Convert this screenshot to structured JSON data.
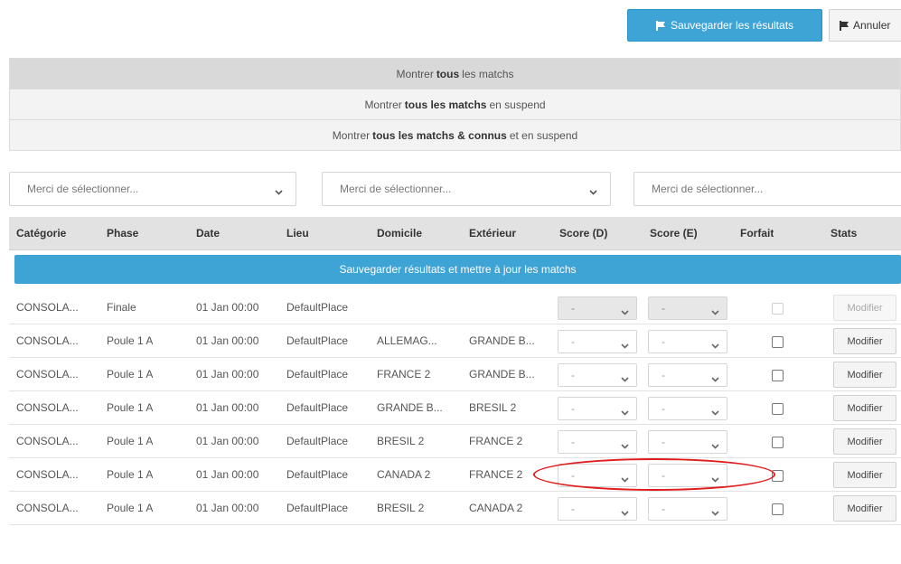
{
  "toolbar": {
    "save_label": "Sauvegarder les résultats",
    "cancel_label": "Annuler",
    "save_icon": "flag-icon",
    "cancel_icon": "flag-icon"
  },
  "filters": {
    "show_all": {
      "prefix": "Montrer",
      "bold": "tous",
      "suffix": "les matchs"
    },
    "show_pending": {
      "prefix": "Montrer",
      "bold": "tous les matchs",
      "suffix": "en suspend"
    },
    "show_known": {
      "prefix": "Montrer",
      "bold": "tous les matchs & connus",
      "suffix": "et en suspend"
    }
  },
  "selects": [
    {
      "placeholder": "Merci de sélectionner..."
    },
    {
      "placeholder": "Merci de sélectionner..."
    },
    {
      "placeholder": "Merci de sélectionner..."
    }
  ],
  "table": {
    "headers": {
      "categorie": "Catégorie",
      "phase": "Phase",
      "date": "Date",
      "lieu": "Lieu",
      "domicile": "Domicile",
      "exterieur": "Extérieur",
      "score_d": "Score (D)",
      "score_e": "Score (E)",
      "forfait": "Forfait",
      "stats": "Stats"
    },
    "banner": "Sauvegarder résultats et mettre à jour les matchs",
    "score_placeholder": "-",
    "modify_label": "Modifier",
    "rows": [
      {
        "categorie": "CONSOLA...",
        "phase": "Finale",
        "date": "01 Jan 00:00",
        "lieu": "DefaultPlace",
        "domicile": "",
        "exterieur": "",
        "disabled": true
      },
      {
        "categorie": "CONSOLA...",
        "phase": "Poule 1 A",
        "date": "01 Jan 00:00",
        "lieu": "DefaultPlace",
        "domicile": "ALLEMAG...",
        "exterieur": "GRANDE B...",
        "disabled": false
      },
      {
        "categorie": "CONSOLA...",
        "phase": "Poule 1 A",
        "date": "01 Jan 00:00",
        "lieu": "DefaultPlace",
        "domicile": "FRANCE 2",
        "exterieur": "GRANDE B...",
        "disabled": false
      },
      {
        "categorie": "CONSOLA...",
        "phase": "Poule 1 A",
        "date": "01 Jan 00:00",
        "lieu": "DefaultPlace",
        "domicile": "GRANDE B...",
        "exterieur": "BRESIL 2",
        "disabled": false
      },
      {
        "categorie": "CONSOLA...",
        "phase": "Poule 1 A",
        "date": "01 Jan 00:00",
        "lieu": "DefaultPlace",
        "domicile": "BRESIL 2",
        "exterieur": "FRANCE 2",
        "disabled": false
      },
      {
        "categorie": "CONSOLA...",
        "phase": "Poule 1 A",
        "date": "01 Jan 00:00",
        "lieu": "DefaultPlace",
        "domicile": "CANADA 2",
        "exterieur": "FRANCE 2",
        "disabled": false
      },
      {
        "categorie": "CONSOLA...",
        "phase": "Poule 1 A",
        "date": "01 Jan 00:00",
        "lieu": "DefaultPlace",
        "domicile": "BRESIL 2",
        "exterieur": "CANADA 2",
        "disabled": false
      }
    ]
  },
  "colors": {
    "accent": "#3ea4d6",
    "annotation": "#e01b1b"
  }
}
